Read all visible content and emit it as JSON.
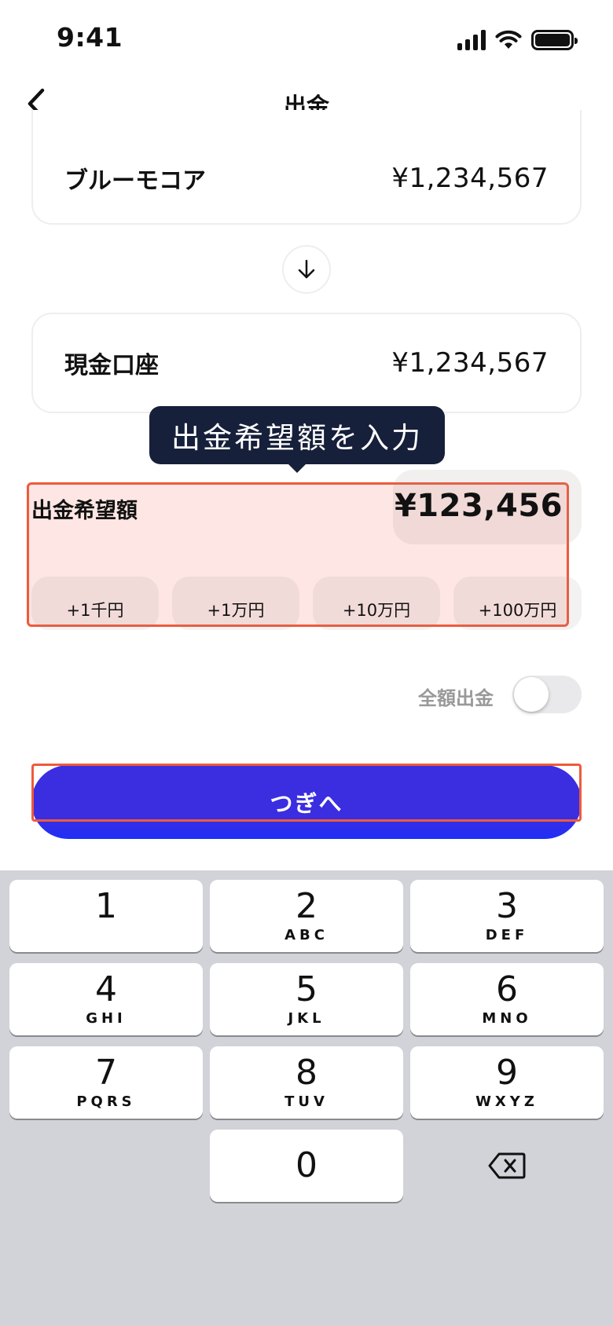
{
  "status_bar": {
    "time": "9:41"
  },
  "nav": {
    "title": "出金"
  },
  "from_account": {
    "name": "ブルーモコア",
    "balance": "¥1,234,567"
  },
  "to_account": {
    "name": "現金口座",
    "balance": "¥1,234,567"
  },
  "tooltip": {
    "text": "出金希望額を入力"
  },
  "amount": {
    "label": "出金希望額",
    "value": "¥123,456",
    "quick_buttons": [
      "+1千円",
      "+1万円",
      "+10万円",
      "+100万円"
    ]
  },
  "full_withdrawal": {
    "label": "全額出金",
    "enabled": false
  },
  "next_button": {
    "label": "つぎへ"
  },
  "keypad": {
    "keys": [
      {
        "digit": "1",
        "letters": ""
      },
      {
        "digit": "2",
        "letters": "ABC"
      },
      {
        "digit": "3",
        "letters": "DEF"
      },
      {
        "digit": "4",
        "letters": "GHI"
      },
      {
        "digit": "5",
        "letters": "JKL"
      },
      {
        "digit": "6",
        "letters": "MNO"
      },
      {
        "digit": "7",
        "letters": "PQRS"
      },
      {
        "digit": "8",
        "letters": "TUV"
      },
      {
        "digit": "9",
        "letters": "WXYZ"
      },
      {
        "digit": "0",
        "letters": ""
      }
    ],
    "backspace_icon": "backspace-icon"
  },
  "colors": {
    "primary": "#3b2de0",
    "highlight": "#ee5a3c",
    "tooltip_bg": "#17203a"
  }
}
